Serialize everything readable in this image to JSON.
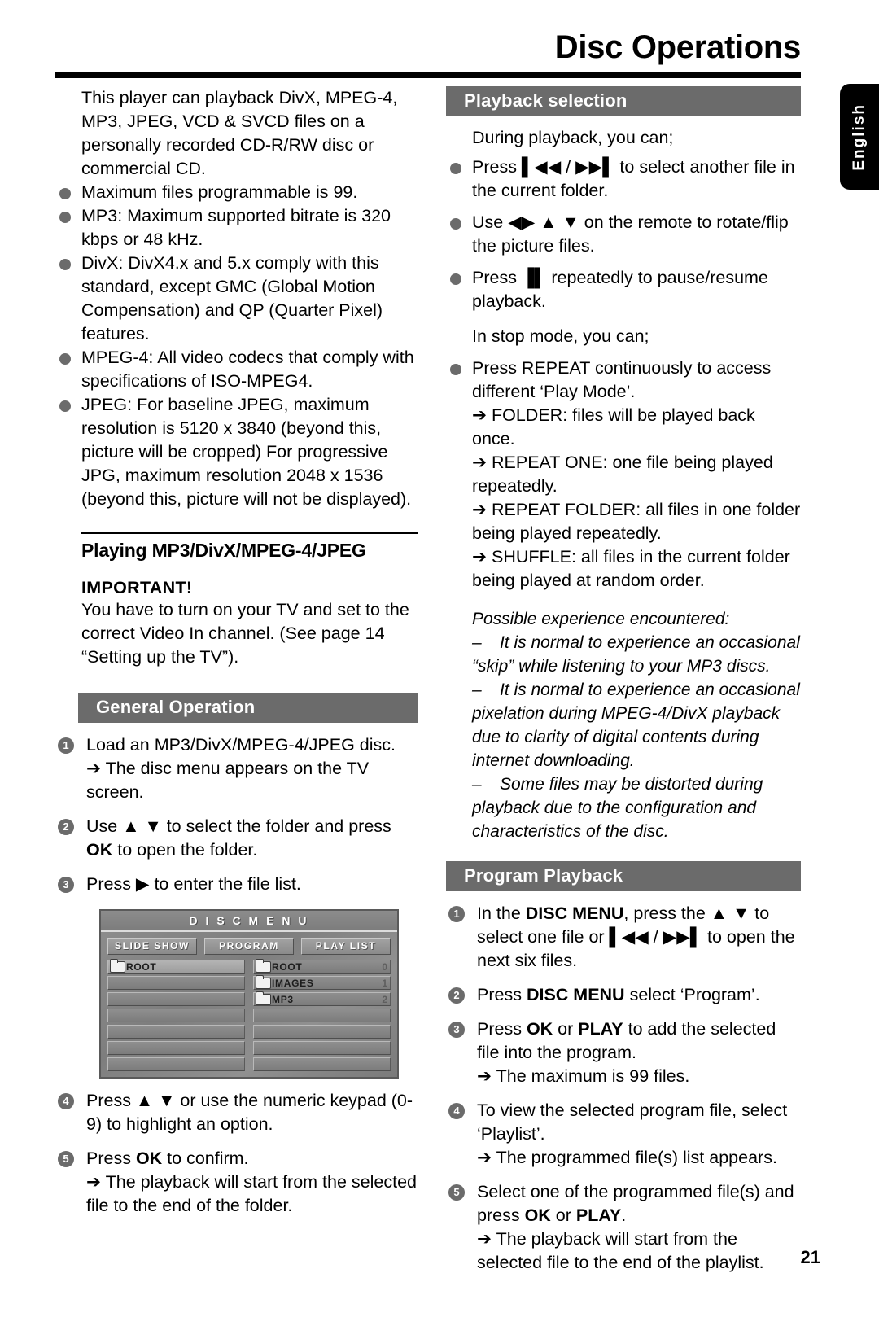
{
  "header": {
    "title": "Disc Operations",
    "lang_tab": "English"
  },
  "page_number": "21",
  "left_column": {
    "intro_paragraph": "This player can playback DivX, MPEG-4, MP3, JPEG, VCD & SVCD files on a personally recorded CD-R/RW disc or commercial CD.",
    "bullets": [
      "Maximum files programmable is 99.",
      "MP3: Maximum supported bitrate is 320 kbps or 48 kHz.",
      "DivX: DivX4.x and 5.x comply with this standard, except GMC (Global Motion Compensation) and QP (Quarter Pixel) features.",
      "MPEG-4: All video codecs that comply with specifications of ISO-MPEG4.",
      "JPEG: For baseline JPEG, maximum resolution is 5120 x 3840 (beyond this, picture will be cropped)  For progressive JPG, maximum resolution 2048 x 1536 (beyond this, picture will not be displayed)."
    ],
    "sub_heading": "Playing MP3/DivX/MPEG-4/JPEG",
    "important_label": "IMPORTANT!",
    "important_text": "You have to turn on your TV and set to the correct Video In channel.  (See page 14 “Setting up the TV”).",
    "section_title": "General Operation",
    "steps": [
      {
        "num": "1",
        "text_parts": [
          {
            "t": "Load an MP3/DivX/MPEG-4/JPEG disc.",
            "bold": false
          }
        ],
        "sub": "➔ The disc menu appears on the TV screen."
      },
      {
        "num": "2",
        "text_parts": [
          {
            "t": "Use ▲ ▼ to select the folder and press ",
            "bold": false
          },
          {
            "t": "OK",
            "bold": true
          },
          {
            "t": " to open the folder.",
            "bold": false
          }
        ],
        "sub": ""
      },
      {
        "num": "3",
        "text_parts": [
          {
            "t": "Press ▶ to enter the file list.",
            "bold": false
          }
        ],
        "sub": ""
      },
      {
        "num": "4",
        "text_parts": [
          {
            "t": "Press ▲ ▼ or use the numeric keypad (0-9) to highlight an option.",
            "bold": false
          }
        ],
        "sub": ""
      },
      {
        "num": "5",
        "text_parts": [
          {
            "t": "Press ",
            "bold": false
          },
          {
            "t": "OK",
            "bold": true
          },
          {
            "t": " to confirm.",
            "bold": false
          }
        ],
        "sub": "➔ The playback will start from the selected file to the end of the folder."
      }
    ]
  },
  "disc_menu_screenshot": {
    "title": "D I S C   M E N U",
    "buttons": [
      "SLIDE SHOW",
      "PROGRAM",
      "PLAY LIST"
    ],
    "left_pane": {
      "rows": [
        {
          "label": "ROOT",
          "folder": true,
          "selected": true,
          "count": ""
        },
        {
          "label": "",
          "folder": false,
          "selected": false,
          "count": ""
        },
        {
          "label": "",
          "folder": false,
          "selected": false,
          "count": ""
        },
        {
          "label": "",
          "folder": false,
          "selected": false,
          "count": ""
        },
        {
          "label": "",
          "folder": false,
          "selected": false,
          "count": ""
        },
        {
          "label": "",
          "folder": false,
          "selected": false,
          "count": ""
        },
        {
          "label": "",
          "folder": false,
          "selected": false,
          "count": ""
        }
      ]
    },
    "right_pane": {
      "rows": [
        {
          "label": "ROOT",
          "folder": true,
          "selected": false,
          "count": "0"
        },
        {
          "label": "IMAGES",
          "folder": true,
          "selected": false,
          "count": "1"
        },
        {
          "label": "MP3",
          "folder": true,
          "selected": false,
          "count": "2"
        },
        {
          "label": "",
          "folder": false,
          "selected": false,
          "count": ""
        },
        {
          "label": "",
          "folder": false,
          "selected": false,
          "count": ""
        },
        {
          "label": "",
          "folder": false,
          "selected": false,
          "count": ""
        },
        {
          "label": "",
          "folder": false,
          "selected": false,
          "count": ""
        }
      ]
    }
  },
  "right_column": {
    "playback_section_title": "Playback selection",
    "during_playback_lead": "During playback, you can;",
    "during_playback_bullets": [
      "Press ▌◀◀ / ▶▶▌ to select another file in the current folder.",
      "Use ◀▶ ▲ ▼ on the remote to rotate/flip the picture files.",
      "Press ▐▌ repeatedly to pause/resume playback."
    ],
    "stop_mode_lead": "In stop mode, you can;",
    "repeat_bullet": "Press REPEAT continuously to access different ‘Play Mode’.",
    "play_modes": [
      "➔ FOLDER: files will be played back once.",
      "➔ REPEAT ONE: one file being played repeatedly.",
      "➔ REPEAT FOLDER: all files in one folder being played repeatedly.",
      "➔ SHUFFLE: all files in the current folder being played at random order."
    ],
    "possible_experience_title": "Possible experience encountered:",
    "possible_experience_items": [
      "It is normal to experience an occasional “skip” while listening to your MP3 discs.",
      "It is normal to experience an occasional pixelation during MPEG-4/DivX playback due to clarity of digital contents during internet downloading.",
      "Some files may be distorted during playback due to the configuration and characteristics of the disc."
    ],
    "program_section_title": "Program Playback",
    "program_steps": [
      {
        "num": "1",
        "parts": [
          {
            "t": "In the ",
            "bold": false
          },
          {
            "t": "DISC MENU",
            "bold": true
          },
          {
            "t": ", press the ▲ ▼ to select one file or ▌◀◀ / ▶▶▌ to open the next six files.",
            "bold": false
          }
        ],
        "sub": ""
      },
      {
        "num": "2",
        "parts": [
          {
            "t": "Press ",
            "bold": false
          },
          {
            "t": "DISC MENU",
            "bold": true
          },
          {
            "t": " select ‘Program’.",
            "bold": false
          }
        ],
        "sub": ""
      },
      {
        "num": "3",
        "parts": [
          {
            "t": "Press ",
            "bold": false
          },
          {
            "t": "OK",
            "bold": true
          },
          {
            "t": " or ",
            "bold": false
          },
          {
            "t": "PLAY",
            "bold": true
          },
          {
            "t": " to add the selected file into the program.",
            "bold": false
          }
        ],
        "sub": "➔ The maximum is 99 files."
      },
      {
        "num": "4",
        "parts": [
          {
            "t": "To view the selected program file, select ‘Playlist’.",
            "bold": false
          }
        ],
        "sub": "➔ The programmed file(s) list appears."
      },
      {
        "num": "5",
        "parts": [
          {
            "t": "Select one of the programmed file(s) and press ",
            "bold": false
          },
          {
            "t": "OK",
            "bold": true
          },
          {
            "t": " or ",
            "bold": false
          },
          {
            "t": "PLAY",
            "bold": true
          },
          {
            "t": ".",
            "bold": false
          }
        ],
        "sub": "➔ The playback will start from the selected file to the end of the playlist."
      }
    ]
  },
  "colors": {
    "section_bar": "#6b6b6b",
    "bullet": "#6b6b6b",
    "tab_bg": "#000000"
  }
}
